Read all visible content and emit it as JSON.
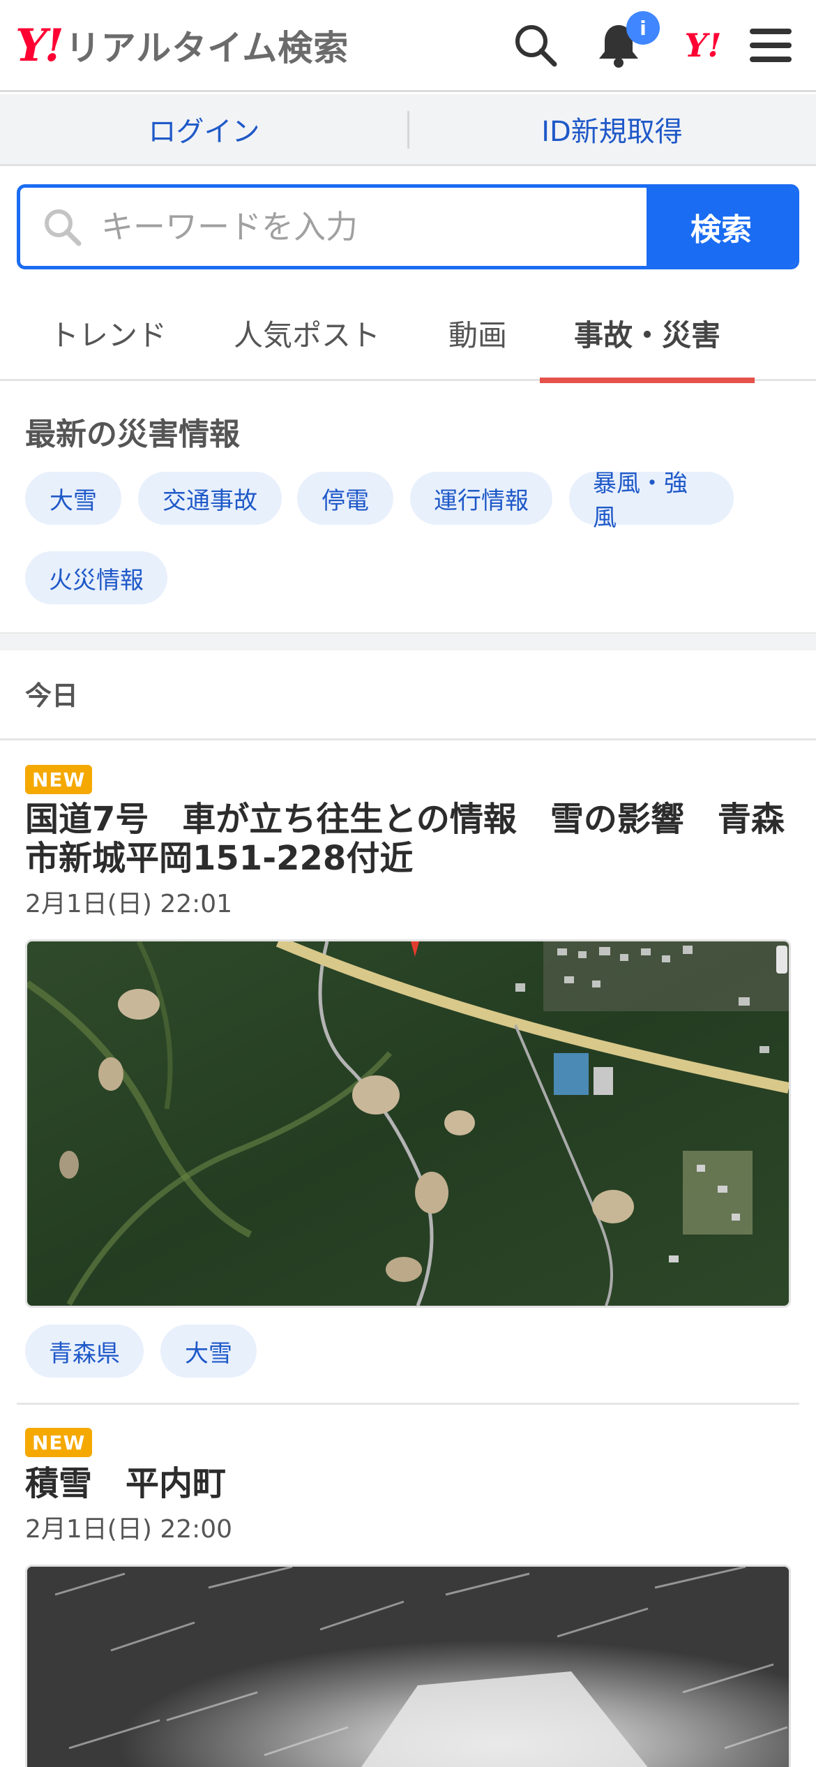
{
  "header": {
    "logo_mark": "Y!",
    "logo_text": "リアルタイム検索",
    "notification_badge": "i",
    "yahoo_mark": "Y!"
  },
  "account": {
    "login_label": "ログイン",
    "signup_label": "ID新規取得"
  },
  "search": {
    "placeholder": "キーワードを入力",
    "button_label": "検索"
  },
  "tabs": [
    {
      "label": "トレンド",
      "active": false
    },
    {
      "label": "人気ポスト",
      "active": false
    },
    {
      "label": "動画",
      "active": false
    },
    {
      "label": "事故・災害",
      "active": true
    }
  ],
  "disaster": {
    "title": "最新の災害情報",
    "chips": [
      "大雪",
      "交通事故",
      "停電",
      "運行情報",
      "暴風・強風",
      "火災情報"
    ]
  },
  "feed": {
    "date_heading": "今日",
    "posts": [
      {
        "badge": "NEW",
        "title": "国道7号　車が立ち往生との情報　雪の影響　青森市新城平岡151-228付近",
        "time": "2月1日(日) 22:01",
        "image": "aerial-map",
        "tags": [
          "青森県",
          "大雪"
        ]
      },
      {
        "badge": "NEW",
        "title": "積雪　平内町",
        "time": "2月1日(日) 22:00",
        "image": "snow-video"
      }
    ]
  },
  "colors": {
    "brand_red": "#ff0033",
    "link_blue": "#1f59c8",
    "search_blue": "#1a6cf2",
    "tab_active_underline": "#e5524a",
    "new_badge": "#f5a800",
    "chip_bg": "#e8f0fc"
  }
}
